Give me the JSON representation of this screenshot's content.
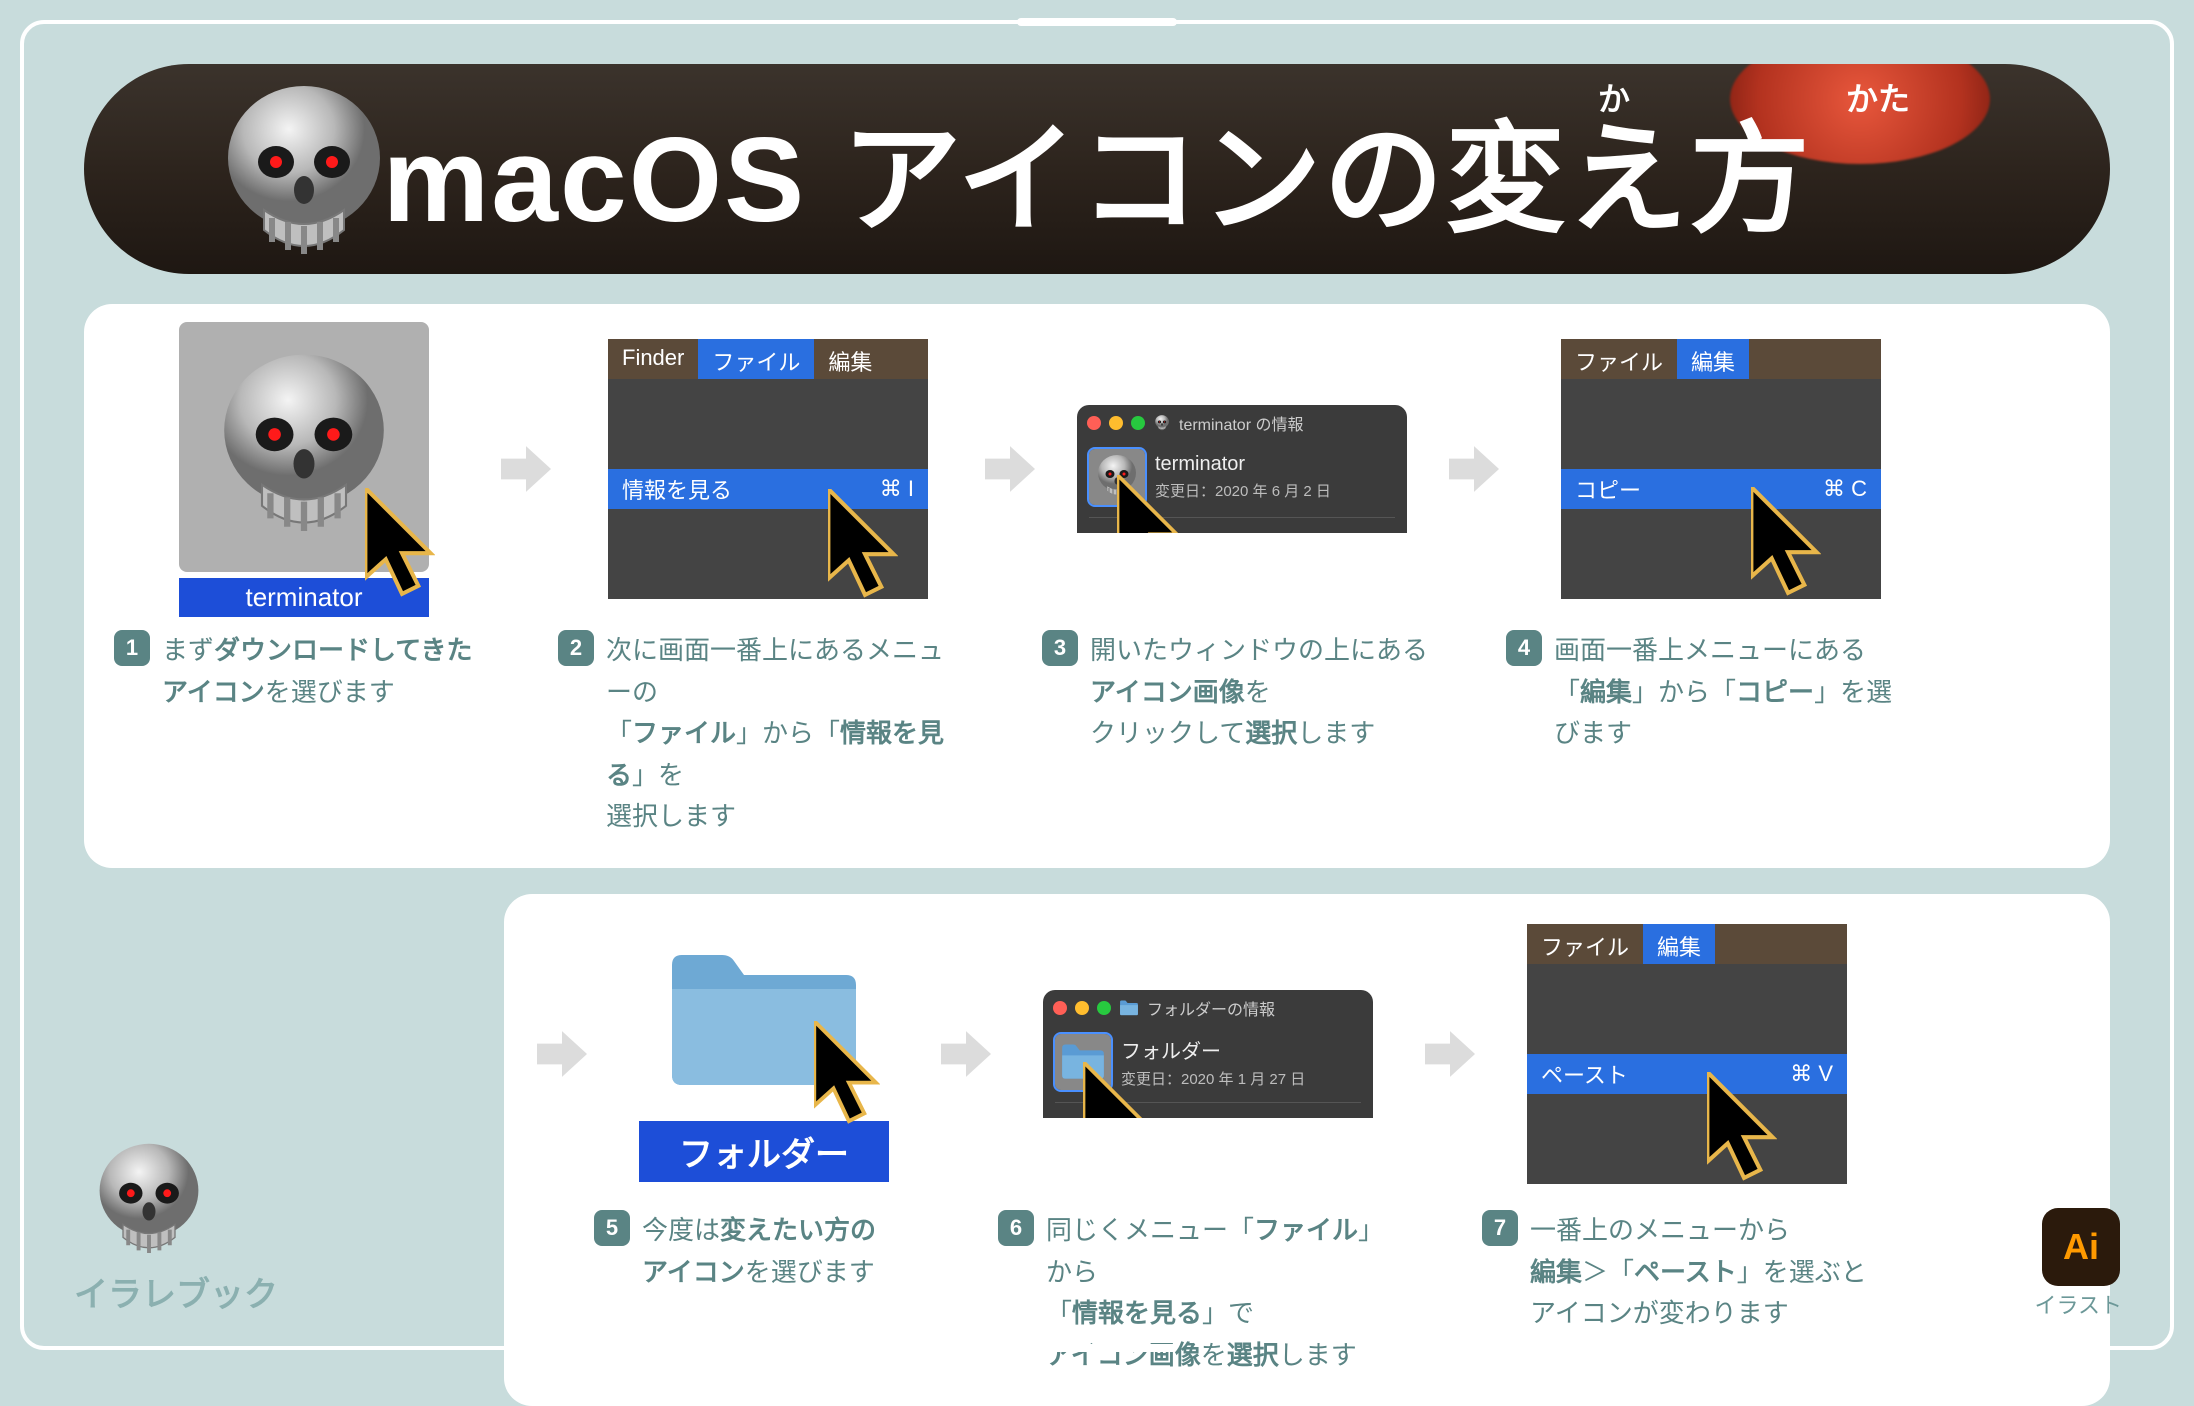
{
  "title": {
    "text": "macOS アイコンの変え方",
    "ruby1": "か",
    "ruby2": "かた"
  },
  "steps": {
    "s1": {
      "num": "1",
      "icon_label": "terminator",
      "caption_html": "まず<b>ダウンロードしてきた</b><br><b>アイコン</b>を選びます"
    },
    "s2": {
      "num": "2",
      "menubar": {
        "finder": "Finder",
        "file": "ファイル",
        "edit": "編集"
      },
      "menu_item": "情報を見る",
      "shortcut": "⌘ I",
      "caption_html": "次に画面一番上にあるメニューの<br>「<b>ファイル</b>」から「<b>情報を見る</b>」を<br>選択します"
    },
    "s3": {
      "num": "3",
      "win_title": "terminator の情報",
      "file_name": "terminator",
      "file_date": "変更日：2020 年 6 月 2 日",
      "caption_html": "開いたウィンドウの上にある<br><b>アイコン画像</b>を<br>クリックして<b>選択</b>します"
    },
    "s4": {
      "num": "4",
      "menubar": {
        "file": "ファイル",
        "edit": "編集"
      },
      "menu_item": "コピー",
      "shortcut": "⌘ C",
      "caption_html": "画面一番上メニューにある<br>「<b>編集</b>」から「<b>コピー</b>」を選びます"
    },
    "s5": {
      "num": "5",
      "icon_label": "フォルダー",
      "caption_html": "今度は<b>変えたい方の</b><br><b>アイコン</b>を選びます"
    },
    "s6": {
      "num": "6",
      "win_title": "フォルダーの情報",
      "file_name": "フォルダー",
      "file_date": "変更日：2020 年 1 月 27 日",
      "caption_html": "同じくメニュー「<b>ファイル</b>」から<br>「<b>情報を見る</b>」で<br><b>アイコン画像</b>を<b>選択</b>します"
    },
    "s7": {
      "num": "7",
      "menubar": {
        "file": "ファイル",
        "edit": "編集"
      },
      "menu_item": "ペースト",
      "shortcut": "⌘ V",
      "caption_html": "一番上のメニューから<br><b>編集</b>＞「<b>ペースト</b>」を選ぶと<br>アイコンが変わります"
    }
  },
  "footer": {
    "brand": "イラレブック",
    "ai": "Ai",
    "ai_caption": "イラスト"
  }
}
